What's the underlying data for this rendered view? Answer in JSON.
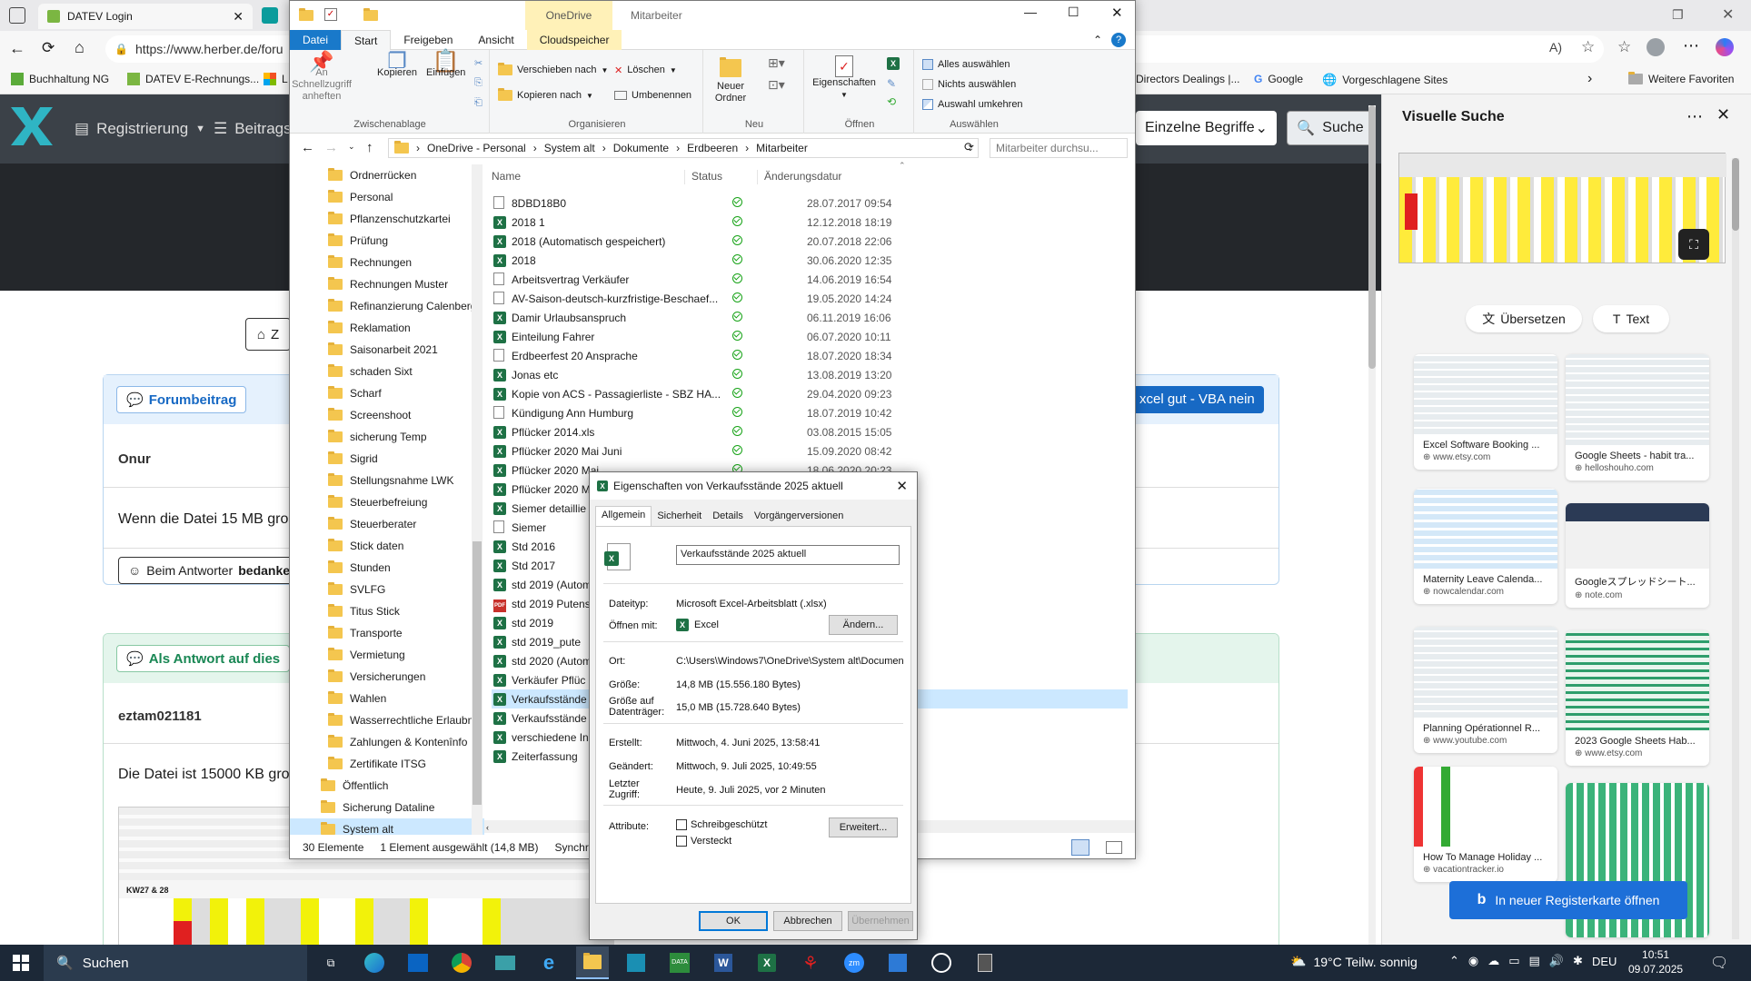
{
  "browser": {
    "tabs": [
      {
        "label": "DATEV Login"
      }
    ],
    "url": "https://www.herber.de/foru",
    "favorites": [
      "Buchhaltung NG",
      "DATEV E-Rechnungs...",
      "L",
      "Directors Dealings |...",
      "Google",
      "Vorgeschlagene Sites"
    ],
    "more_favorites": "Weitere Favoriten"
  },
  "herber": {
    "nav_register": "Registrierung",
    "nav_posts": "Beitrags",
    "search_mode": "Einzelne Begriffe",
    "search_button": "Suche",
    "home_button": "Z",
    "forum_post_label": "Forumbeitrag",
    "level_badge": "xcel gut - VBA nein",
    "author1": "Onur",
    "post1_text": "Wenn die Datei 15 MB gro",
    "thanks_prefix": "Beim Antworter ",
    "thanks_bold": "bedanke",
    "answer_label": "Als Antwort auf dies",
    "author2": "eztam021181",
    "post2_text": "Die Datei ist 15000 KB gro",
    "sheet_label": "KW27 & 28"
  },
  "explorer": {
    "qat_tab": "OneDrive",
    "window_title": "Mitarbeiter",
    "tabs": [
      "Datei",
      "Start",
      "Freigeben",
      "Ansicht",
      "Cloudspeicher"
    ],
    "ribbon": {
      "pin": "An Schnellzugriff anheften",
      "copy": "Kopieren",
      "paste": "Einfügen",
      "move_to": "Verschieben nach",
      "copy_to": "Kopieren nach",
      "delete": "Löschen",
      "rename": "Umbenennen",
      "new_folder": "Neuer Ordner",
      "properties": "Eigenschaften",
      "select_all": "Alles auswählen",
      "select_none": "Nichts auswählen",
      "invert": "Auswahl umkehren",
      "grp_clipboard": "Zwischenablage",
      "grp_organize": "Organisieren",
      "grp_new": "Neu",
      "grp_open": "Öffnen",
      "grp_select": "Auswählen"
    },
    "breadcrumb": [
      "OneDrive - Personal",
      "System alt",
      "Dokumente",
      "Erdbeeren",
      "Mitarbeiter"
    ],
    "search_placeholder": "Mitarbeiter durchsu...",
    "columns": {
      "name": "Name",
      "status": "Status",
      "date": "Änderungsdatur"
    },
    "nav_folders": [
      "Ordnerrücken",
      "Personal",
      "Pflanzenschutzkartei",
      "Prüfung",
      "Rechnungen",
      "Rechnungen Muster",
      "Refinanzierung Calenberg",
      "Reklamation",
      "Saisonarbeit 2021",
      "schaden Sixt",
      "Scharf",
      "Screenshoot",
      "sicherung Temp",
      "Sigrid",
      "Stellungsnahme LWK",
      "Steuerbefreiung",
      "Steuerberater",
      "Stick daten",
      "Stunden",
      "SVLFG",
      "Titus Stick",
      "Transporte",
      "Vermietung",
      "Versicherungen",
      "Wahlen",
      "Wasserrechtliche Erlaubn",
      "Zahlungen & Kontenînfo",
      "Zertifikate ITSG"
    ],
    "nav_top": [
      "Öffentlich",
      "Sicherung Dataline",
      "System alt"
    ],
    "files": [
      {
        "name": "8DBD18B0",
        "type": "doc",
        "date": "28.07.2017 09:54"
      },
      {
        "name": "2018  1",
        "type": "xls",
        "date": "12.12.2018 18:19"
      },
      {
        "name": "2018 (Automatisch gespeichert)",
        "type": "xls",
        "date": "20.07.2018 22:06"
      },
      {
        "name": "2018",
        "type": "xls",
        "date": "30.06.2020 12:35"
      },
      {
        "name": "Arbeitsvertrag Verkäufer",
        "type": "doc",
        "date": "14.06.2019 16:54"
      },
      {
        "name": "AV-Saison-deutsch-kurzfristige-Beschaef...",
        "type": "doc",
        "date": "19.05.2020 14:24"
      },
      {
        "name": "Damir Urlaubsanspruch",
        "type": "xls",
        "date": "06.11.2019 16:06"
      },
      {
        "name": "Einteilung Fahrer",
        "type": "xls",
        "date": "06.07.2020 10:11"
      },
      {
        "name": "Erdbeerfest 20 Ansprache",
        "type": "doc",
        "date": "18.07.2020 18:34"
      },
      {
        "name": "Jonas etc",
        "type": "xls",
        "date": "13.08.2019 13:20"
      },
      {
        "name": "Kopie von ACS - Passagierliste - SBZ HA...",
        "type": "xls",
        "date": "29.04.2020 09:23"
      },
      {
        "name": "Kündigung Ann Humburg",
        "type": "doc",
        "date": "18.07.2019 10:42"
      },
      {
        "name": "Pflücker 2014.xls",
        "type": "xls",
        "date": "03.08.2015 15:05"
      },
      {
        "name": "Pflücker 2020 Mai Juni",
        "type": "xls",
        "date": "15.09.2020 08:42"
      },
      {
        "name": "Pflücker 2020 Mai",
        "type": "xls",
        "date": "18.06.2020 20:23"
      },
      {
        "name": "Pflücker 2020 M",
        "type": "xls",
        "date": ""
      },
      {
        "name": "Siemer detaillie",
        "type": "xls",
        "date": ""
      },
      {
        "name": "Siemer",
        "type": "doc",
        "date": ""
      },
      {
        "name": "Std 2016",
        "type": "xls",
        "date": ""
      },
      {
        "name": "Std 2017",
        "type": "xls",
        "date": ""
      },
      {
        "name": "std 2019 (Autom",
        "type": "xls",
        "date": ""
      },
      {
        "name": "std 2019 Putens",
        "type": "pdf",
        "date": ""
      },
      {
        "name": "std 2019",
        "type": "xls",
        "date": ""
      },
      {
        "name": "std 2019_pute",
        "type": "xls",
        "date": ""
      },
      {
        "name": "std 2020 (Autom",
        "type": "xls",
        "date": ""
      },
      {
        "name": "Verkäufer  Pflüc",
        "type": "xls",
        "date": ""
      },
      {
        "name": "Verkaufsstände",
        "type": "xls",
        "date": ""
      },
      {
        "name": "Verkaufsstände",
        "type": "xls",
        "date": ""
      },
      {
        "name": "verschiedene In",
        "type": "xls",
        "date": ""
      },
      {
        "name": "Zeiterfassung",
        "type": "xls",
        "date": ""
      }
    ],
    "status_count": "30 Elemente",
    "status_selected": "1 Element ausgewählt (14,8 MB)",
    "status_sync": "Synchro"
  },
  "dialog": {
    "title": "Eigenschaften von Verkaufsstände 2025 aktuell",
    "tabs": [
      "Allgemein",
      "Sicherheit",
      "Details",
      "Vorgängerversionen"
    ],
    "filename": "Verkaufsstände 2025 aktuell",
    "type_label": "Dateityp:",
    "type_value": "Microsoft Excel-Arbeitsblatt (.xlsx)",
    "open_label": "Öffnen mit:",
    "open_value": "Excel",
    "change_button": "Ändern...",
    "loc_label": "Ort:",
    "loc_value": "C:\\Users\\Windows7\\OneDrive\\System alt\\Documen",
    "size_label": "Größe:",
    "size_value": "14,8 MB (15.556.180 Bytes)",
    "disk_label": "Größe auf Datenträger:",
    "disk_value": "15,0 MB (15.728.640 Bytes)",
    "created_label": "Erstellt:",
    "created_value": "Mittwoch, 4. Juni 2025, 13:58:41",
    "modified_label": "Geändert:",
    "modified_value": "Mittwoch, 9. Juli 2025, 10:49:55",
    "access_label": "Letzter Zugriff:",
    "access_value": "Heute, 9. Juli 2025, vor 2 Minuten",
    "attr_label": "Attribute:",
    "readonly": "Schreibgeschützt",
    "hidden": "Versteckt",
    "advanced": "Erweitert...",
    "ok": "OK",
    "cancel": "Abbrechen",
    "apply": "Übernehmen"
  },
  "visual_search": {
    "title": "Visuelle Suche",
    "translate": "Übersetzen",
    "text": "Text",
    "results": [
      {
        "title": "Excel Software Booking ...",
        "url": "www.etsy.com"
      },
      {
        "title": "Google Sheets - habit tra...",
        "url": "helloshouho.com"
      },
      {
        "title": "Maternity Leave Calenda...",
        "url": "nowcalendar.com"
      },
      {
        "title": "Googleスプレッドシート...",
        "url": "note.com"
      },
      {
        "title": "Planning Opérationnel R...",
        "url": "www.youtube.com"
      },
      {
        "title": "2023 Google Sheets Hab...",
        "url": "www.etsy.com"
      },
      {
        "title": "How To Manage Holiday ...",
        "url": "vacationtracker.io"
      },
      {
        "title": "",
        "url": ""
      }
    ],
    "open_new_tab": "In neuer Registerkarte öffnen"
  },
  "taskbar": {
    "search": "Suchen",
    "weather": "19°C  Teilw. sonnig",
    "lang": "DEU",
    "time": "10:51",
    "date": "09.07.2025"
  }
}
